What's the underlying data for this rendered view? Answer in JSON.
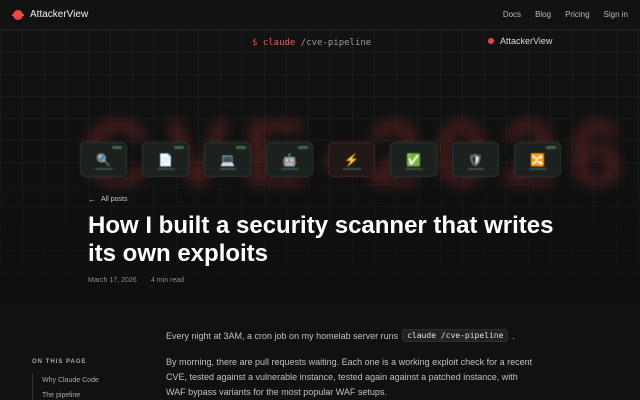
{
  "nav": {
    "brand": "AttackerView",
    "links": [
      "Docs",
      "Blog",
      "Pricing",
      "Sign in"
    ]
  },
  "hero": {
    "command_prompt": "$",
    "command_word": "claude",
    "command_arg": "/cve-pipeline",
    "brand": "AttackerView",
    "background_text": "CVE-2026",
    "pipeline_icons": [
      "search-icon",
      "document-icon",
      "terminal-icon",
      "bot-icon",
      "bolt-icon",
      "check-icon",
      "shield-icon",
      "merge-icon"
    ]
  },
  "post": {
    "back_link": "All posts",
    "title": "How I built a security scanner that writes its own exploits",
    "date": "March 17, 2026",
    "read_time": "4 min read"
  },
  "toc": {
    "heading": "ON THIS PAGE",
    "items": [
      "Why Claude Code",
      "The pipeline"
    ]
  },
  "body": {
    "p1_prefix": "Every night at 3AM, a cron job on my homelab server runs",
    "p1_code": "claude /cve-pipeline",
    "p1_suffix": ".",
    "p2": "By morning, there are pull requests waiting. Each one is a working exploit check for a recent CVE, tested against a vulnerable instance, tested again against a patched instance, with WAF bypass variants for the most popular WAF setups."
  },
  "colors": {
    "accent": "#e44444",
    "background": "#0f0f0f",
    "card_green": "#1a211e",
    "card_red": "#231818"
  }
}
